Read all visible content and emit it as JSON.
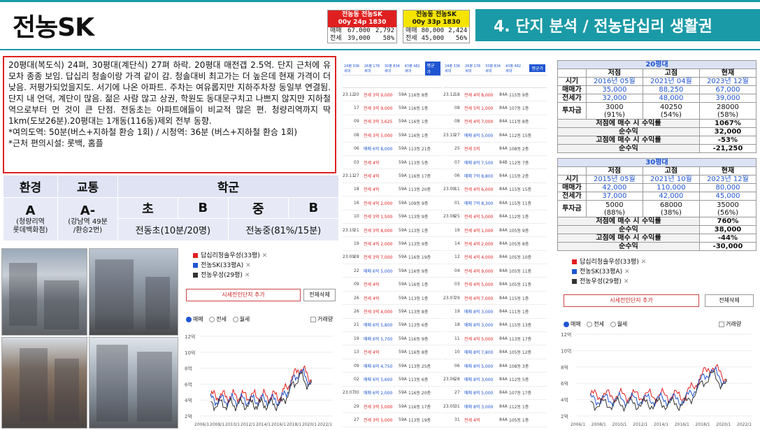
{
  "header": {
    "title": "전농SK",
    "section": "4. 단지 분석 / 전농답십리 생활권",
    "box1": {
      "line1": "전농동 전농SK",
      "line2": "00y 24p 1830",
      "rows": [
        [
          "매매",
          "67.000",
          "2,792"
        ],
        [
          "전세",
          "39,000",
          "58%"
        ]
      ]
    },
    "box2": {
      "line1": "전농동 전농SK",
      "line2": "00y 33p 1830",
      "rows": [
        [
          "매매",
          "80,000",
          "2,424"
        ],
        [
          "전세",
          "45,000",
          "56%"
        ]
      ]
    }
  },
  "description": "20평대(복도식) 24펴, 30평대(계단식) 27펴 하락. 20평대 매전갭 2.5억. 단지 근처에 유모차 종종 보임. 답십리 청솔이랑 가격 같이 감. 청솔대비 최고가는 더 높은데 현재 가격이 더 낮음. 저평가되었을지도. 서기에 나온 아파트. 주차는 여유롭지만 지하주차장 동일부 연결됨. 단지 내 언덕, 계단이 많음. 젊은 사람 많고 상권, 학원도 동대문구치고 나쁘지 않지만 지하철역으로부터 먼 것이 큰 단점. 전동초는 아파트애들이 비교적 많은 편. 청량리역까지 딱 1km(도보26분).20평대는 1개동(116동)제외 전부 동향.",
  "commute": "*여의도역: 50분(버스+지하철 환승 1회) / 시청역: 36분 (버스+지하철 환승 1회)",
  "amenity": "*근처 편의시설: 롯백, 홈플",
  "school": {
    "headers": [
      "환경",
      "교통",
      "학군"
    ],
    "env_grade": "A",
    "env_note": "(청량리역\n롯데백화점)",
    "traffic_grade": "A-",
    "traffic_note": "(강남역 49분\n/환승2번)",
    "elem_label": "초",
    "elem_grade": "B",
    "mid_label": "중",
    "mid_grade": "B",
    "elem_name": "전동초(10분/20명)",
    "mid_name": "전농중(81%/15분)"
  },
  "chart_widget": {
    "legend": [
      {
        "name": "답십리청솔우성(33평)",
        "color": "#e02020"
      },
      {
        "name": "전농SK(33평A)",
        "color": "#1f55d1"
      },
      {
        "name": "전농우성(29평)",
        "color": "#333333"
      }
    ],
    "add_label": "시세전인단지 추가",
    "del_label": "전체삭제",
    "radio": [
      "매매",
      "전세",
      "월세"
    ],
    "check": "거래량",
    "y_ticks": [
      "12억",
      "10억",
      "8억",
      "6억",
      "4억",
      "2억"
    ],
    "x_ticks": [
      "2006/1",
      "2008/1",
      "2010/1",
      "2012/1",
      "2014/1",
      "2016/1",
      "2018/1",
      "2020/1",
      "2022/1"
    ]
  },
  "listing_left": {
    "tabs": [
      "24평 336세대",
      "26평 178세대",
      "30평 834세대",
      "43평 482세대"
    ],
    "btn": "평균가",
    "rows": [
      [
        "23.12",
        "20",
        "전세 3억 9,000",
        "59A",
        "116동 8층"
      ],
      [
        "",
        "17",
        "전세 3억 9,000",
        "59A",
        "116동 1층"
      ],
      [
        "",
        "09",
        "전세 3억 3,625",
        "59A",
        "116동 1층"
      ],
      [
        "",
        "08",
        "전세 3억 5,000",
        "59A",
        "116동 1층"
      ],
      [
        "",
        "06",
        "매매 6억 8,000",
        "59A",
        "113동 21층"
      ],
      [
        "",
        "03",
        "전세 4억",
        "59A",
        "113동 5층"
      ],
      [
        "23.11",
        "27",
        "전세 4억",
        "59A",
        "116동 17층"
      ],
      [
        "",
        "18",
        "전세 4억",
        "59A",
        "113동 20층"
      ],
      [
        "",
        "16",
        "전세 4억 2,000",
        "59A",
        "109동 9층"
      ],
      [
        "",
        "10",
        "전세 3억 1,500",
        "59A",
        "113동 9층"
      ],
      [
        "23.10",
        "21",
        "전세 3억 8,000",
        "59A",
        "113동 1층"
      ],
      [
        "",
        "19",
        "전세 4억 2,000",
        "59A",
        "113동 9층"
      ],
      [
        "23.09",
        "28",
        "전세 3억 7,000",
        "59A",
        "116동 19층"
      ],
      [
        "",
        "22",
        "매매 6억 5,000",
        "59A",
        "116동 9층"
      ],
      [
        "",
        "09",
        "전세 4억",
        "59A",
        "116동 1층"
      ],
      [
        "",
        "26",
        "전세 4억",
        "59A",
        "113동 1층"
      ],
      [
        "",
        "26",
        "전세 3억 4,000",
        "59A",
        "113동 8층"
      ],
      [
        "",
        "21",
        "매매 6억 5,800",
        "59A",
        "113동 6층"
      ],
      [
        "",
        "19",
        "매매 6억 5,700",
        "59A",
        "116동 9층"
      ],
      [
        "",
        "13",
        "전세 4억",
        "59A",
        "116동 8층"
      ],
      [
        "",
        "09",
        "매매 6억 4,750",
        "59A",
        "113동 25층"
      ],
      [
        "",
        "02",
        "매매 6억 5,600",
        "59A",
        "113동 6층"
      ],
      [
        "23.07",
        "30",
        "매매 6억 2,000",
        "59A",
        "116동 20층"
      ],
      [
        "",
        "29",
        "전세 3억 5,000",
        "59A",
        "116동 17층"
      ],
      [
        "",
        "27",
        "전세 3억 5,000",
        "59A",
        "113동 19층"
      ],
      [
        "",
        "26",
        "매매 6억 3,000",
        "59A",
        "113동 25층"
      ]
    ]
  },
  "listing_right": {
    "tabs": [
      "24평 336세대",
      "26평 178세대",
      "33평 834세대",
      "43평 482세대"
    ],
    "btn": "평균가",
    "rows": [
      [
        "23.12",
        "18",
        "전세 4억 8,000",
        "84A",
        "115동 9층"
      ],
      [
        "",
        "08",
        "전세 5억 1,000",
        "84A",
        "107동 1층"
      ],
      [
        "",
        "08",
        "전세 4억 7,000",
        "84A",
        "111동 8층"
      ],
      [
        "23.10",
        "27",
        "매매 8억 5,000",
        "84A",
        "112동 15층"
      ],
      [
        "",
        "25",
        "전세 5억",
        "84A",
        "108동 2층"
      ],
      [
        "",
        "07",
        "매매 8억 7,500",
        "84B",
        "112동 7층"
      ],
      [
        "",
        "06",
        "매매 7억 8,800",
        "84A",
        "115동 2층"
      ],
      [
        "23.09",
        "11",
        "전세 4억 6,000",
        "84A",
        "115동 15층"
      ],
      [
        "",
        "01",
        "매매 7억 8,300",
        "84A",
        "115동 11층"
      ],
      [
        "23.08",
        "25",
        "전세 4억 5,000",
        "84A",
        "112동 1층"
      ],
      [
        "",
        "19",
        "전세 4억 1,000",
        "84A",
        "105동 9층"
      ],
      [
        "",
        "14",
        "전세 4억 2,000",
        "84A",
        "105동 8층"
      ],
      [
        "",
        "12",
        "전세 4억 4,000",
        "84A",
        "105동 10층"
      ],
      [
        "",
        "04",
        "전세 4억 9,000",
        "84A",
        "105동 11층"
      ],
      [
        "",
        "03",
        "전세 4억 5,000",
        "84A",
        "105동 11층"
      ],
      [
        "23.07",
        "29",
        "전세 4억 7,000",
        "84A",
        "115동 1층"
      ],
      [
        "",
        "19",
        "매매 8억 3,000",
        "84A",
        "111동 1층"
      ],
      [
        "",
        "18",
        "매매 8억 3,000",
        "84A",
        "115동 13층"
      ],
      [
        "",
        "11",
        "전세 4억 5,000",
        "84A",
        "113동 17층"
      ],
      [
        "",
        "10",
        "매매 8억 7,800",
        "84A",
        "105동 12층"
      ],
      [
        "",
        "06",
        "매매 8억 5,000",
        "84A",
        "108동 3층"
      ],
      [
        "23.06",
        "28",
        "매매 8억 3,000",
        "84A",
        "112동 5층"
      ],
      [
        "",
        "27",
        "매매 8억 5,000",
        "84A",
        "107동 17층"
      ],
      [
        "23.05",
        "31",
        "매매 8억 3,000",
        "84A",
        "112동 1층"
      ],
      [
        "",
        "31",
        "전세 4억",
        "84A",
        "105동 1층"
      ]
    ]
  },
  "stats20": {
    "title": "20평대",
    "cols": [
      "저점",
      "고점",
      "현재"
    ],
    "period": [
      "시기",
      "2016년 05월",
      "2021년 04월",
      "2023년 12월"
    ],
    "sale": [
      "매매가",
      "35,000",
      "88,250",
      "67,000"
    ],
    "jeonse": [
      "전세가",
      "32,000",
      "48,000",
      "39,000"
    ],
    "invest_label": "투자금",
    "invest": [
      "3000",
      "40250",
      "28000"
    ],
    "invest_pct": [
      "(91%)",
      "(54%)",
      "(58%)"
    ],
    "rows": [
      [
        "저점에 매수 시 수익률",
        "1067%"
      ],
      [
        "순수익",
        "32,000"
      ],
      [
        "고점에 매수 시 수익률",
        "-53%"
      ],
      [
        "순수익",
        "-21,250"
      ]
    ]
  },
  "stats30": {
    "title": "30평대",
    "cols": [
      "저점",
      "고점",
      "현재"
    ],
    "period": [
      "시기",
      "2015년 05월",
      "2021년 10월",
      "2023년 12월"
    ],
    "sale": [
      "매매가",
      "42,000",
      "110,000",
      "80,000"
    ],
    "jeonse": [
      "전세가",
      "37,000",
      "42,000",
      "45,000"
    ],
    "invest_label": "투자금",
    "invest": [
      "5000",
      "68000",
      "35000"
    ],
    "invest_pct": [
      "(88%)",
      "(38%)",
      "(56%)"
    ],
    "rows": [
      [
        "저점에 매수 시 수익률",
        "760%"
      ],
      [
        "순수익",
        "38,000"
      ],
      [
        "고점에 매수 시 수익률",
        "-44%"
      ],
      [
        "순수익",
        "-30,000"
      ]
    ]
  }
}
